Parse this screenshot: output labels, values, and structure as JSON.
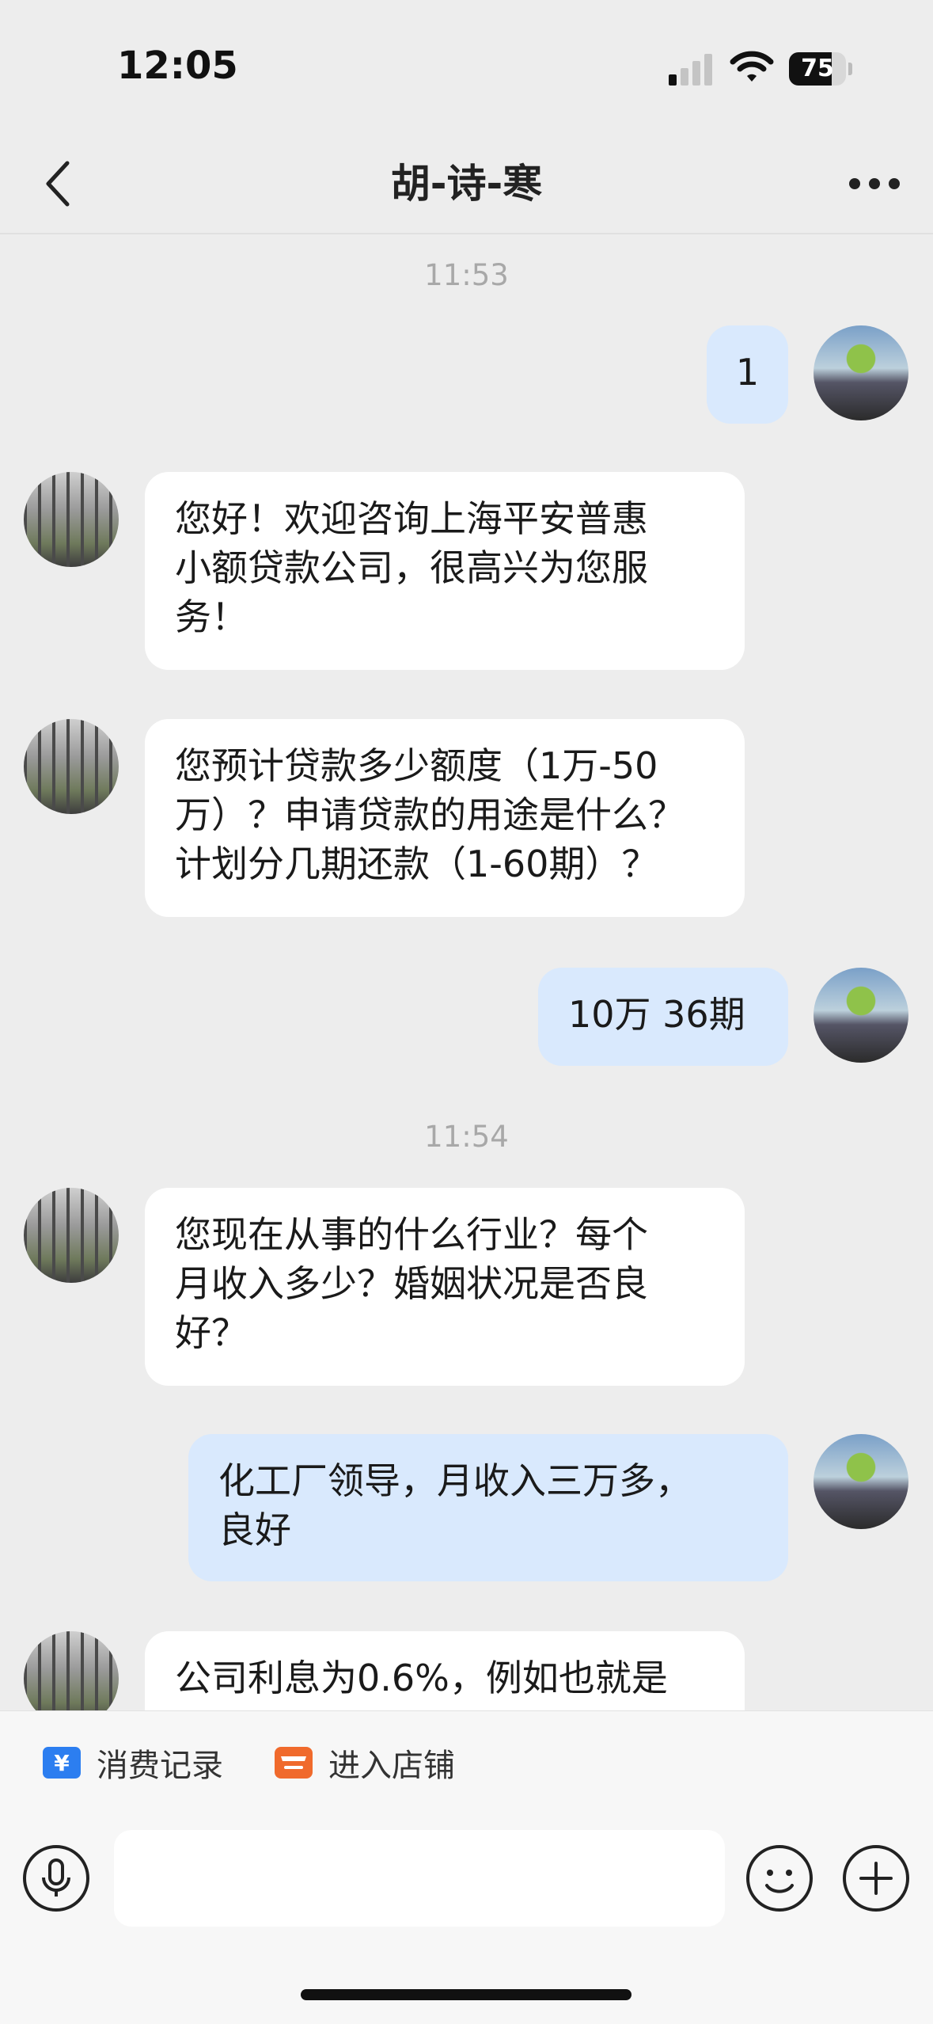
{
  "status_bar": {
    "time": "12:05",
    "battery_level": "75"
  },
  "nav": {
    "title": "胡-诗-寒",
    "back_icon": "chevron-left-icon",
    "more_icon": "more-dots-icon"
  },
  "chat": {
    "time_1": "11:53",
    "msg_1": "1",
    "msg_2": "您好！欢迎咨询上海平安普惠\n小额贷款公司，很高兴为您服\n务！",
    "msg_3": "您预计贷款多少额度（1万-50\n万）？申请贷款的用途是什么？\n计划分几期还款（1-60期）？",
    "msg_4": "10万 36期",
    "time_2": "11:54",
    "msg_5": "您现在从事的什么行业？每个\n月收入多少？婚姻状况是否良\n好？",
    "msg_6": "化工厂领导，月收入三万多，\n良好",
    "msg_7": "公司利息为0.6%，例如也就是"
  },
  "bottom": {
    "action_1": "消费记录",
    "action_2": "进入店铺",
    "input_placeholder": "",
    "colors": {
      "action_1_icon": "#2c7ef0",
      "action_2_icon": "#f06a2c"
    }
  },
  "colors": {
    "background": "#ededed",
    "bubble_out": "#d9e9fd",
    "bubble_in": "#ffffff"
  }
}
